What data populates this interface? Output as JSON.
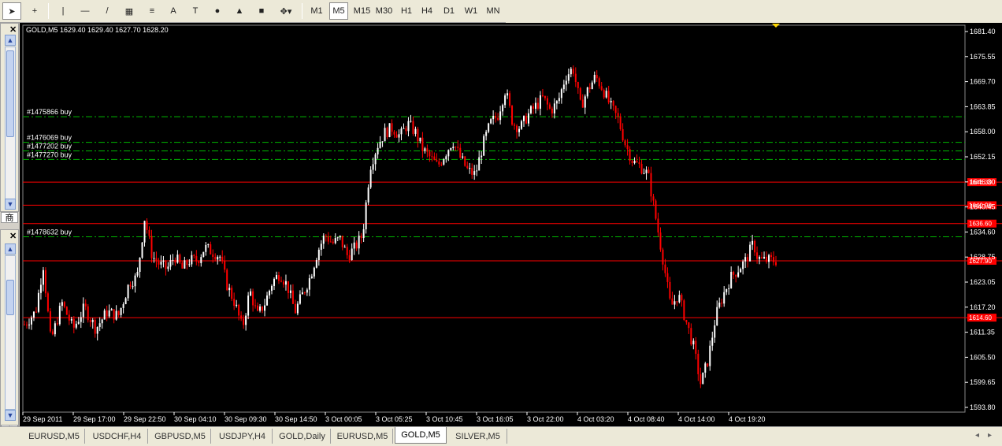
{
  "toolbar": {
    "tools": [
      {
        "name": "cursor-icon",
        "glyph": "➤"
      },
      {
        "name": "crosshair-icon",
        "glyph": "+"
      },
      {
        "name": "vertical-line-icon",
        "glyph": "|"
      },
      {
        "name": "horizontal-line-icon",
        "glyph": "—"
      },
      {
        "name": "trendline-icon",
        "glyph": "/"
      },
      {
        "name": "equidistant-channel-icon",
        "glyph": "▦"
      },
      {
        "name": "fibonacci-retracement-icon",
        "glyph": "≡"
      },
      {
        "name": "text-icon",
        "glyph": "A"
      },
      {
        "name": "text-label-icon",
        "glyph": "T"
      },
      {
        "name": "ellipse-icon",
        "glyph": "●"
      },
      {
        "name": "triangle-icon",
        "glyph": "▲"
      },
      {
        "name": "rectangle-icon",
        "glyph": "■"
      },
      {
        "name": "arrows-dropdown-icon",
        "glyph": "✥▾"
      }
    ],
    "timeframes": [
      "M1",
      "M5",
      "M15",
      "M30",
      "H1",
      "H4",
      "D1",
      "W1",
      "MN"
    ],
    "active_timeframe": "M5"
  },
  "chart": {
    "header": "GOLD,M5  1629.40 1629.40 1627.70 1628.20",
    "colors": {
      "background": "#000000",
      "candle_up": "#ffffff",
      "candle_down": "#ff0000",
      "order_line": "#00b800",
      "level_line": "#ff0000",
      "axis_text": "#ffffff",
      "level_label_bg": "#ff0000"
    },
    "price_axis": [
      "1681.40",
      "1675.55",
      "1669.70",
      "1663.85",
      "1658.00",
      "1652.15",
      "1646.30",
      "1640.45",
      "1634.60",
      "1628.75",
      "1623.05",
      "1617.20",
      "1611.35",
      "1605.50",
      "1599.65",
      "1593.80"
    ],
    "time_axis": [
      "29 Sep 2011",
      "29 Sep 17:00",
      "29 Sep 22:50",
      "30 Sep 04:10",
      "30 Sep 09:30",
      "30 Sep 14:50",
      "3 Oct 00:05",
      "3 Oct 05:25",
      "3 Oct 10:45",
      "3 Oct 16:05",
      "3 Oct 22:00",
      "4 Oct 03:20",
      "4 Oct 08:40",
      "4 Oct 14:00",
      "4 Oct 19:20"
    ],
    "order_lines": [
      {
        "label": "#1475866 buy",
        "price": 1661.6
      },
      {
        "label": "#1476069 buy",
        "price": 1655.6
      },
      {
        "label": "#1477202 buy",
        "price": 1653.6
      },
      {
        "label": "#1477270 buy",
        "price": 1651.6
      },
      {
        "label": "#1478632 buy",
        "price": 1633.5
      }
    ],
    "level_lines": [
      {
        "price": 1646.3,
        "label": "1646.30"
      },
      {
        "price": 1640.9,
        "label": "1640.90"
      },
      {
        "price": 1636.6,
        "label": "1636.60"
      },
      {
        "price": 1627.9,
        "label": "1627.90"
      },
      {
        "price": 1614.6,
        "label": "1614.60"
      }
    ],
    "y_range": [
      1592.5,
      1683.0
    ],
    "price_path": [
      [
        0.0,
        1613
      ],
      [
        0.015,
        1616
      ],
      [
        0.025,
        1627
      ],
      [
        0.035,
        1609
      ],
      [
        0.05,
        1618
      ],
      [
        0.065,
        1612
      ],
      [
        0.08,
        1617
      ],
      [
        0.095,
        1612
      ],
      [
        0.11,
        1616
      ],
      [
        0.125,
        1615
      ],
      [
        0.14,
        1623
      ],
      [
        0.15,
        1624
      ],
      [
        0.16,
        1638
      ],
      [
        0.17,
        1629
      ],
      [
        0.18,
        1627
      ],
      [
        0.19,
        1626
      ],
      [
        0.2,
        1629
      ],
      [
        0.21,
        1626
      ],
      [
        0.22,
        1628
      ],
      [
        0.23,
        1628
      ],
      [
        0.24,
        1631
      ],
      [
        0.25,
        1630
      ],
      [
        0.26,
        1629
      ],
      [
        0.27,
        1622
      ],
      [
        0.28,
        1618
      ],
      [
        0.29,
        1612
      ],
      [
        0.3,
        1621
      ],
      [
        0.31,
        1615
      ],
      [
        0.32,
        1618
      ],
      [
        0.33,
        1623
      ],
      [
        0.34,
        1625
      ],
      [
        0.35,
        1622
      ],
      [
        0.36,
        1616
      ],
      [
        0.37,
        1620
      ],
      [
        0.38,
        1624
      ],
      [
        0.39,
        1630
      ],
      [
        0.4,
        1634
      ],
      [
        0.41,
        1632
      ],
      [
        0.42,
        1633
      ],
      [
        0.43,
        1629
      ],
      [
        0.44,
        1631
      ],
      [
        0.45,
        1634
      ],
      [
        0.46,
        1650
      ],
      [
        0.47,
        1655
      ],
      [
        0.48,
        1658
      ],
      [
        0.49,
        1659
      ],
      [
        0.5,
        1657
      ],
      [
        0.51,
        1660
      ],
      [
        0.52,
        1658
      ],
      [
        0.53,
        1654
      ],
      [
        0.54,
        1652
      ],
      [
        0.55,
        1650
      ],
      [
        0.56,
        1653
      ],
      [
        0.57,
        1656
      ],
      [
        0.58,
        1652
      ],
      [
        0.59,
        1649
      ],
      [
        0.6,
        1648
      ],
      [
        0.61,
        1655
      ],
      [
        0.62,
        1660
      ],
      [
        0.63,
        1662
      ],
      [
        0.64,
        1668
      ],
      [
        0.65,
        1660
      ],
      [
        0.66,
        1659
      ],
      [
        0.67,
        1662
      ],
      [
        0.68,
        1664
      ],
      [
        0.69,
        1666
      ],
      [
        0.7,
        1663
      ],
      [
        0.71,
        1665
      ],
      [
        0.72,
        1671
      ],
      [
        0.73,
        1673
      ],
      [
        0.74,
        1664
      ],
      [
        0.75,
        1668
      ],
      [
        0.76,
        1671
      ],
      [
        0.77,
        1668
      ],
      [
        0.78,
        1664
      ],
      [
        0.79,
        1661
      ],
      [
        0.8,
        1655
      ],
      [
        0.81,
        1651
      ],
      [
        0.82,
        1650
      ],
      [
        0.83,
        1648
      ],
      [
        0.84,
        1638
      ],
      [
        0.85,
        1628
      ],
      [
        0.86,
        1617
      ],
      [
        0.87,
        1620
      ],
      [
        0.88,
        1614
      ],
      [
        0.89,
        1608
      ],
      [
        0.9,
        1599
      ],
      [
        0.91,
        1605
      ],
      [
        0.92,
        1615
      ],
      [
        0.93,
        1620
      ],
      [
        0.94,
        1624
      ],
      [
        0.95,
        1626
      ],
      [
        0.96,
        1628
      ],
      [
        0.97,
        1632
      ],
      [
        0.975,
        1629
      ],
      [
        0.98,
        1628
      ]
    ]
  },
  "left_panel": {
    "top_label": "商",
    "bottom_label": "常"
  },
  "tabs": [
    "EURUSD,M5",
    "USDCHF,H4",
    "GBPUSD,M5",
    "USDJPY,H4",
    "GOLD,Daily",
    "EURUSD,M5",
    "GOLD,M5",
    "SILVER,M5"
  ],
  "active_tab": "GOLD,M5"
}
